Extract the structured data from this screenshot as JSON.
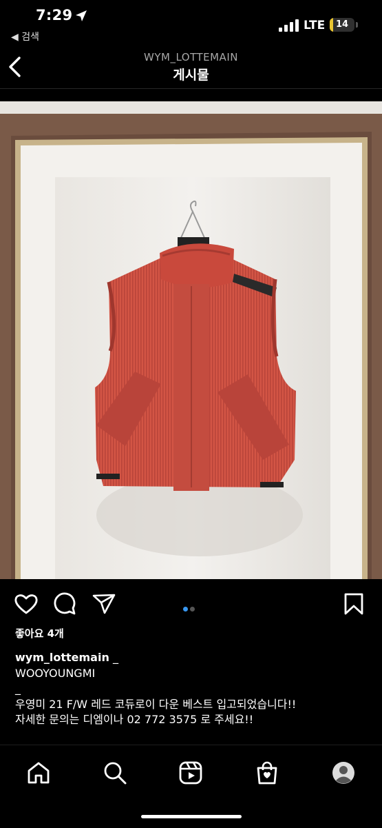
{
  "status_bar": {
    "time": "7:29",
    "back_to_app_label": "◀ 검색",
    "network": "LTE",
    "battery_level": "14",
    "battery_fraction": 0.14
  },
  "header": {
    "username": "WYM_LOTTEMAIN",
    "title": "게시물"
  },
  "post": {
    "carousel": {
      "total": 2,
      "current": 1,
      "active_color": "#3897f0",
      "inactive_color": "#555555"
    },
    "likes_text": "좋아요 4개",
    "caption": {
      "username": "wym_lottemain",
      "line1_rest": " _",
      "line2": "WOOYOUNGMI",
      "line3": "_",
      "line4": "우영미 21 F/W 레드 코듀로이 다운 베스트 입고되었습니다!!",
      "line5": "자세한 문의는 디엠이나 02 772 3575 로 주세요!!"
    }
  },
  "colors": {
    "vest": "#d25244",
    "background": "#000000",
    "frame": "#7a5a48"
  },
  "icons": {
    "like": "heart-icon",
    "comment": "comment-icon",
    "share": "share-icon",
    "save": "bookmark-icon",
    "tabs": [
      "home-icon",
      "search-icon",
      "reels-icon",
      "shop-icon",
      "profile-icon"
    ]
  }
}
